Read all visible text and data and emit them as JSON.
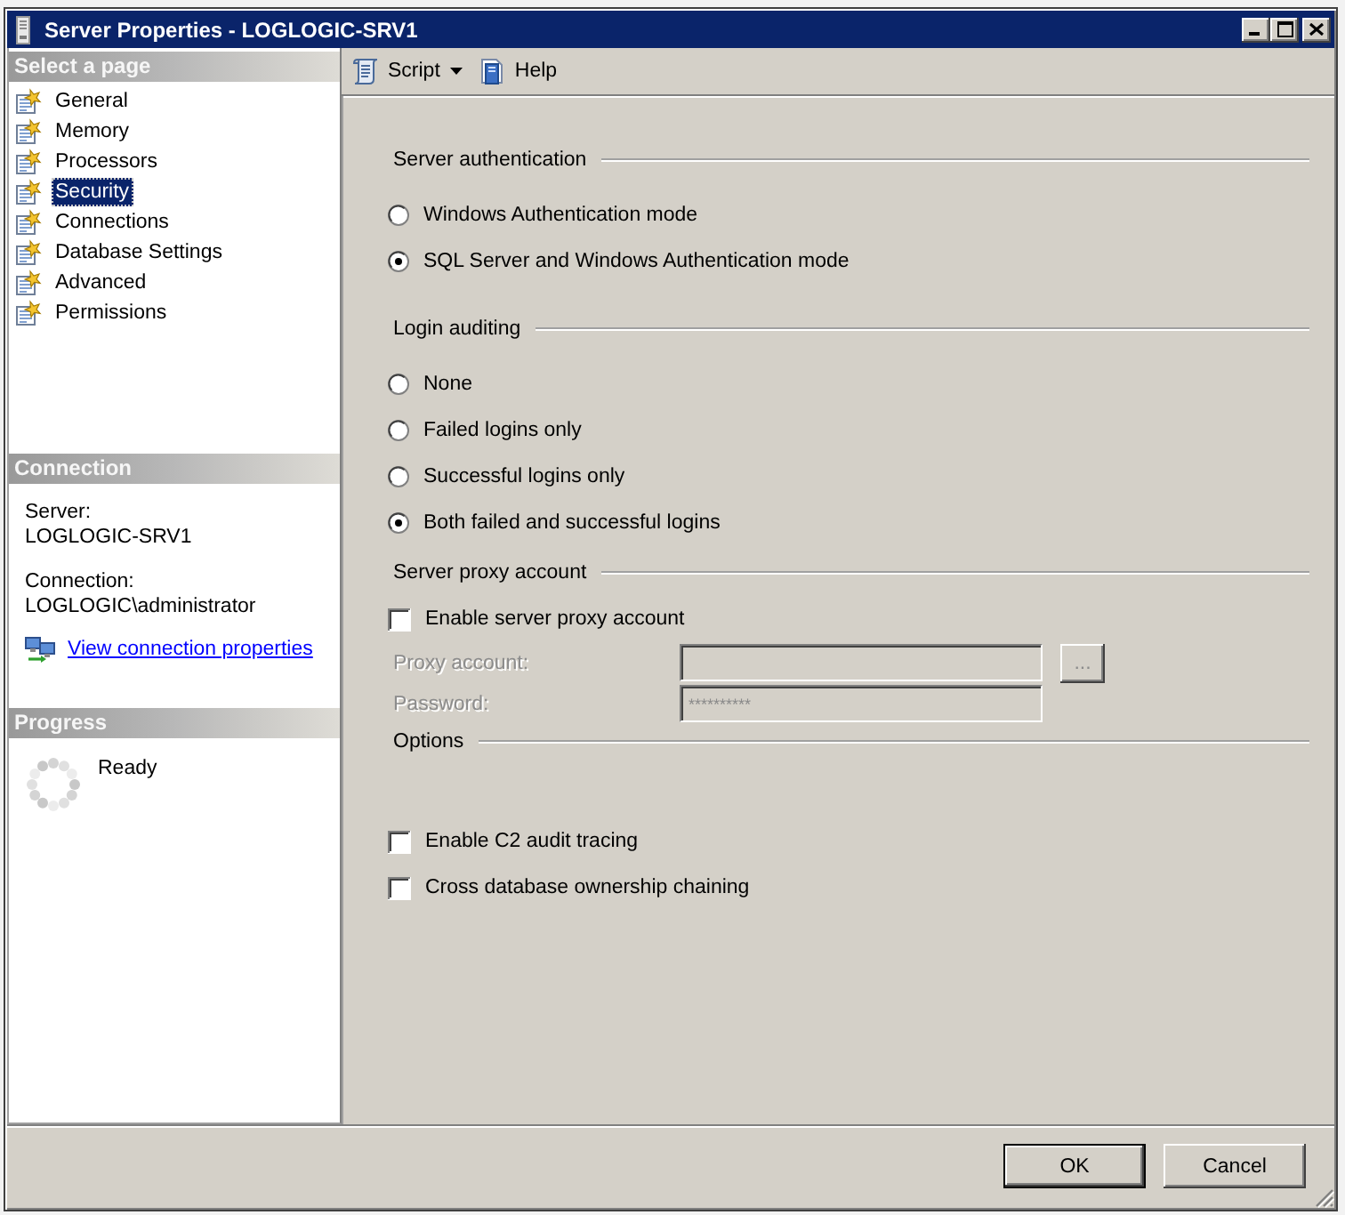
{
  "window": {
    "title": "Server Properties - LOGLOGIC-SRV1"
  },
  "sidebar": {
    "pages": {
      "header": "Select a page",
      "items": [
        {
          "label": "General",
          "selected": false
        },
        {
          "label": "Memory",
          "selected": false
        },
        {
          "label": "Processors",
          "selected": false
        },
        {
          "label": "Security",
          "selected": true
        },
        {
          "label": "Connections",
          "selected": false
        },
        {
          "label": "Database Settings",
          "selected": false
        },
        {
          "label": "Advanced",
          "selected": false
        },
        {
          "label": "Permissions",
          "selected": false
        }
      ]
    },
    "connection": {
      "header": "Connection",
      "fields": [
        {
          "label": "Server:",
          "value": "LOGLOGIC-SRV1"
        },
        {
          "label": "Connection:",
          "value": "LOGLOGIC\\administrator"
        }
      ],
      "link": "View connection properties"
    },
    "progress": {
      "header": "Progress",
      "status": "Ready"
    }
  },
  "toolbar": [
    {
      "kind": "script",
      "label": "Script",
      "dropdown": true
    },
    {
      "kind": "help",
      "label": "Help",
      "dropdown": false
    }
  ],
  "sections": [
    {
      "title": "Server authentication",
      "items": [
        {
          "kind": "radio",
          "label": "Windows Authentication mode",
          "selected": false
        },
        {
          "kind": "radio",
          "label": "SQL Server and Windows Authentication mode",
          "selected": true
        }
      ]
    },
    {
      "title": "Login auditing",
      "items": [
        {
          "kind": "radio",
          "label": "None",
          "selected": false
        },
        {
          "kind": "radio",
          "label": "Failed logins only",
          "selected": false
        },
        {
          "kind": "radio",
          "label": "Successful logins only",
          "selected": false
        },
        {
          "kind": "radio",
          "label": "Both failed and successful logins",
          "selected": true
        }
      ]
    },
    {
      "title": "Server proxy account",
      "items": [
        {
          "kind": "checkbox",
          "label": "Enable server proxy account",
          "checked": false
        },
        {
          "kind": "text_field",
          "label": "Proxy account:",
          "disabled": true,
          "button": "..."
        },
        {
          "kind": "password_field",
          "label": "Password:",
          "disabled": true,
          "value": "**********"
        }
      ]
    },
    {
      "title": "Options",
      "items": [
        {
          "kind": "checkbox",
          "label": "Enable C2 audit tracing",
          "checked": false
        },
        {
          "kind": "checkbox",
          "label": "Cross database ownership chaining",
          "checked": false
        }
      ]
    }
  ],
  "buttons": [
    {
      "label": "OK",
      "default": true
    },
    {
      "label": "Cancel",
      "default": false
    }
  ]
}
